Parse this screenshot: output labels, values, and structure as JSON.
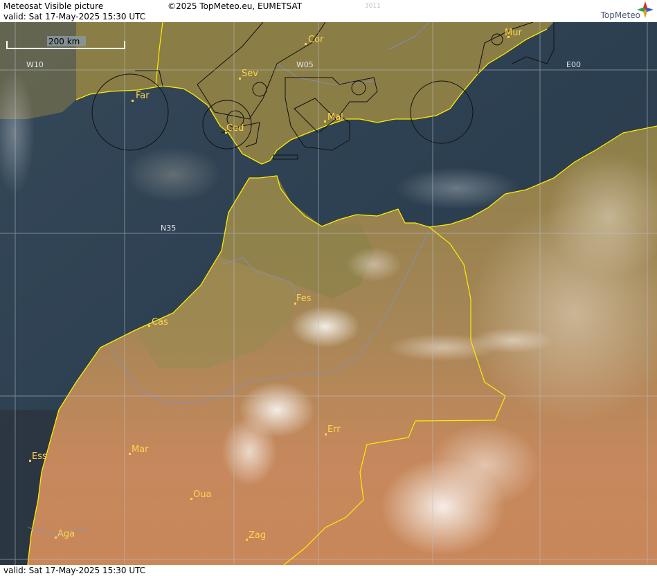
{
  "header": {
    "title": "Meteosat Visible picture",
    "copyright": "©2025 TopMeteo.eu, EUMETSAT",
    "code": "3011",
    "valid": "valid:  Sat  17-May-2025  15:30 UTC",
    "logo_text": "TopMeteo"
  },
  "footer": {
    "valid": "valid:  Sat  17-May-2025  15:30 UTC"
  },
  "map": {
    "scale_label": "200 km",
    "grid_labels": [
      "W10",
      "W05",
      "E00",
      "N35"
    ],
    "cities": [
      {
        "name": "Cor"
      },
      {
        "name": "Mur"
      },
      {
        "name": "Sev"
      },
      {
        "name": "Far"
      },
      {
        "name": "Mal"
      },
      {
        "name": "Ced"
      },
      {
        "name": "Fes"
      },
      {
        "name": "Cas"
      },
      {
        "name": "Err"
      },
      {
        "name": "Mar"
      },
      {
        "name": "Ess"
      },
      {
        "name": "Oua"
      },
      {
        "name": "Aga"
      },
      {
        "name": "Zag"
      }
    ],
    "colors": {
      "sea": "#1b2a3a",
      "land_north": "#8a7a45",
      "land_south": "#c9875a",
      "coast": "#ffee00",
      "city": "#ffd54a",
      "grid": "#b9c2cc"
    }
  }
}
